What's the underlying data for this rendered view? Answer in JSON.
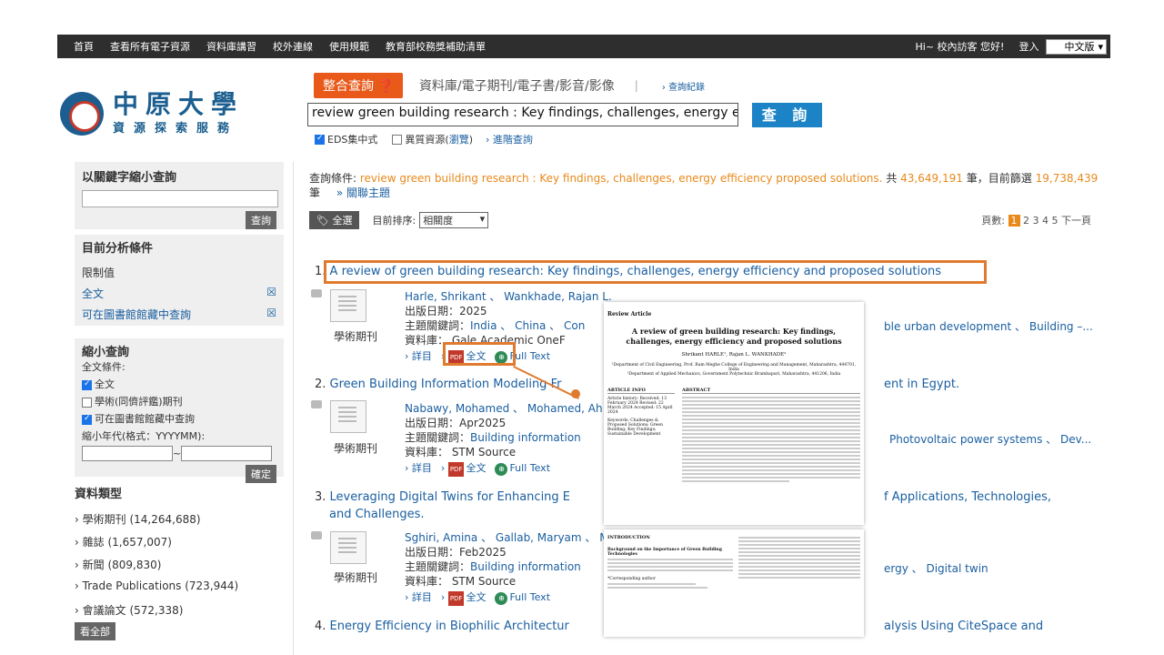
{
  "topnav": {
    "items": [
      "首頁",
      "查看所有電子資源",
      "資料庫講習",
      "校外連線",
      "使用規範",
      "教育部校務獎補助清單"
    ],
    "greeting": "Hi~ 校內訪客 您好!",
    "login": "登入",
    "lang": "中文版"
  },
  "logo": {
    "big": "中原大學",
    "small": "資源探索服務"
  },
  "search": {
    "integrated_label": "整合查詢",
    "tab_text": "資料庫/電子期刊/電子書/影音/影像",
    "history": "› 查詢紀錄",
    "query": "review green building research : Key findings, challenges, energy efficiency proposed solutions.",
    "button": "查 詢",
    "opt_eds": "EDS集中式",
    "opt_hetero": "異質資源(",
    "opt_browse": "瀏覽",
    "opt_close": ")",
    "advanced": "› 進階查詢"
  },
  "sidebar": {
    "keyword_head": "以關鍵字縮小查詢",
    "keyword_btn": "查詢",
    "analysis_head": "目前分析條件",
    "limit_label": "限制值",
    "limit1": "全文",
    "limit2": "可在圖書館館藏中查詢",
    "narrow_head": "縮小查詢",
    "fulltext_cond": "全文條件:",
    "cb_full": "全文",
    "cb_peer": "學術(同儕評鑑)期刊",
    "cb_lib": "可在圖書館館藏中查詢",
    "date_label": "縮小年代(格式：YYYYMM):",
    "confirm": "確定",
    "type_head": "資料類型",
    "types": [
      {
        "name": "學術期刊",
        "count": "(14,264,688)"
      },
      {
        "name": "雜誌",
        "count": "(1,657,007)"
      },
      {
        "name": "新聞",
        "count": "(809,830)"
      },
      {
        "name": "Trade Publications",
        "count": "(723,944)"
      },
      {
        "name": "會議論文",
        "count": "(572,338)"
      }
    ],
    "view_all": "看全部"
  },
  "condition": {
    "prefix": "查詢條件:",
    "query": "review green building research : Key findings, challenges, energy efficiency proposed solutions.",
    "total_label": "共",
    "total": "43,649,191",
    "unit": "筆",
    "filtered_label": "，目前篩選",
    "filtered": "19,738,439",
    "unit2": "筆",
    "related": "» 關聯主題"
  },
  "toolbar": {
    "all": "全選",
    "sort_label": "目前排序:",
    "sort_value": "相關度",
    "pages_label": "頁數:",
    "pages": [
      "1",
      "2",
      "3",
      "4",
      "5"
    ],
    "next": "下一頁"
  },
  "results": [
    {
      "num": "1.",
      "title": "A review of green building research: Key findings, challenges, energy efficiency and proposed solutions",
      "authors": "Harle, Shrikant 、 Wankhade, Rajan L.",
      "date": "出版日期：2025",
      "keywords_label": "主題關鍵詞：",
      "keywords": "India 、 China 、 Con",
      "db": "資料庫： Gale Academic OneF",
      "type": "學術期刊",
      "right": "ble urban development 、 Building –..."
    },
    {
      "num": "2.",
      "title": "Green Building Information Modeling Fr",
      "title_right": "ent in Egypt.",
      "authors": "Nabawy, Mohamed 、 Mohamed, Ah",
      "date": "出版日期：Apr2025",
      "keywords_label": "主題關鍵詞：",
      "keywords": "Building information",
      "db": "資料庫： STM Source",
      "type": "學術期刊",
      "right": "Photovoltaic power systems 、 Dev..."
    },
    {
      "num": "3.",
      "title": "Leveraging Digital Twins for Enhancing E",
      "title_line2": "and Challenges.",
      "title_right": "f Applications, Technologies,",
      "authors": "Sghiri, Amina 、 Gallab, Maryam 、 M",
      "date": "出版日期：Feb2025",
      "keywords_label": "主題關鍵詞：",
      "keywords": "Building information",
      "db": "資料庫： STM Source",
      "type": "學術期刊",
      "right": "ergy 、 Digital twin"
    },
    {
      "num": "4.",
      "title": "Energy Efficiency in Biophilic Architectur",
      "title_right": "alysis Using CiteSpace and"
    }
  ],
  "links": {
    "detail": "詳目",
    "fulltext": "全文",
    "fulltext_link": "Full Text"
  },
  "paper": {
    "kind": "Review Article",
    "title": "A review of green building research: Key findings, challenges, energy efficiency and proposed solutions",
    "authors": "Shrikant HARLE¹, Rajan L. WANKHADE²",
    "aff1": "¹Department of Civil Engineering, Prof. Ram Meghe College of Engineering and Management, Maharashtra, 444701, India",
    "aff2": "²Department of Applied Mechanics, Government Polytechnic Bramhapuri, Maharashtra, 441206, India",
    "info_head": "ARTICLE INFO",
    "info_body": "Article history: Received: 13 February 2024 Revised: 22 March 2024 Accepted: 15 April 2024",
    "keywords": "Keywords: Challenges & Proposed Solutions; Green Building; Key Findings; Sustainable Development",
    "abstract_head": "ABSTRACT",
    "intro_head": "INTRODUCTION",
    "bg_head": "Background on the Importance of Green Building Technologies",
    "corr": "*Corresponding author"
  }
}
